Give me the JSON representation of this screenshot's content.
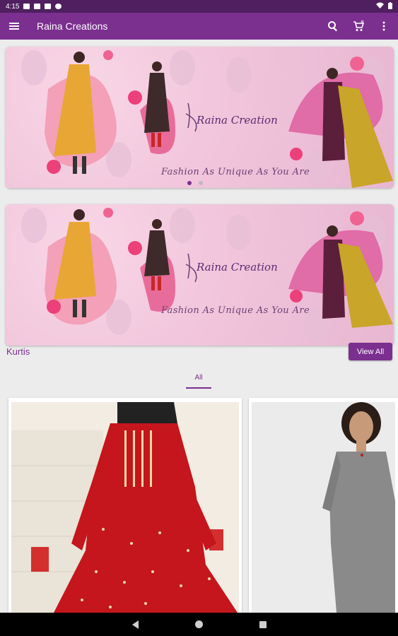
{
  "status_bar": {
    "time": "4:15"
  },
  "app_bar": {
    "title": "Raina Creations",
    "menu_icon": "menu-icon",
    "search_icon": "search-icon",
    "cart_icon": "cart-icon",
    "more_icon": "more-vert-icon",
    "color": "#7b2f8f"
  },
  "banners": [
    {
      "brand": "Raina Creation",
      "tagline": "Fashion As Unique As You Are"
    },
    {
      "brand": "Raina Creation",
      "tagline": "Fashion As Unique As You Are"
    }
  ],
  "carousel": {
    "pages": 2,
    "active_index": 0
  },
  "section": {
    "title": "Kurtis",
    "view_all_label": "View All",
    "tabs": [
      {
        "label": "All",
        "active": true
      }
    ]
  },
  "products": [
    {
      "image": "red-embroidered-kurti"
    },
    {
      "image": "grey-silk-kurti"
    }
  ],
  "nav": {
    "back": "back-icon",
    "home": "home-icon",
    "recents": "recents-icon"
  }
}
